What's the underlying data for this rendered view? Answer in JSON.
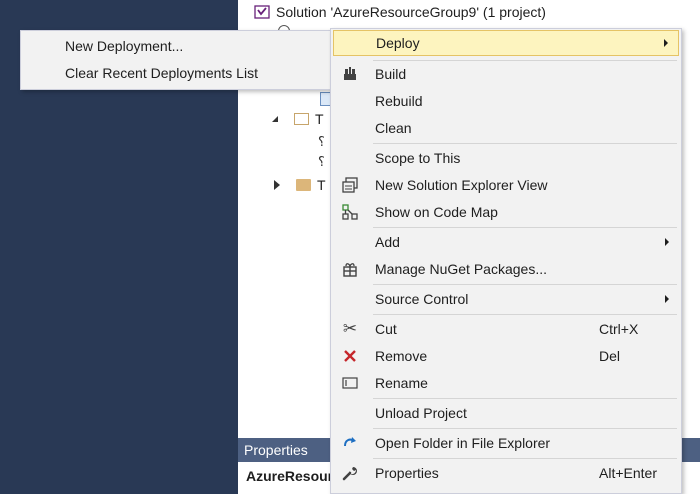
{
  "explorer": {
    "solution_label": "Solution 'AzureResourceGroup9' (1 project)",
    "row_t1": "T",
    "row_t2": "T"
  },
  "properties": {
    "header": "Properties",
    "object_name": "AzureResour"
  },
  "submenu": {
    "items": [
      "New Deployment...",
      "Clear Recent Deployments List"
    ]
  },
  "menu": {
    "deploy": "Deploy",
    "build": "Build",
    "rebuild": "Rebuild",
    "clean": "Clean",
    "scope": "Scope to This",
    "new_view": "New Solution Explorer View",
    "code_map": "Show on Code Map",
    "add": "Add",
    "nuget": "Manage NuGet Packages...",
    "source_control": "Source Control",
    "cut": "Cut",
    "cut_shortcut": "Ctrl+X",
    "remove": "Remove",
    "remove_shortcut": "Del",
    "rename": "Rename",
    "unload": "Unload Project",
    "open_folder": "Open Folder in File Explorer",
    "properties": "Properties",
    "properties_shortcut": "Alt+Enter"
  },
  "colors": {
    "background": "#293955",
    "highlight": "#fdf4bf",
    "properties_header": "#4d6082"
  }
}
